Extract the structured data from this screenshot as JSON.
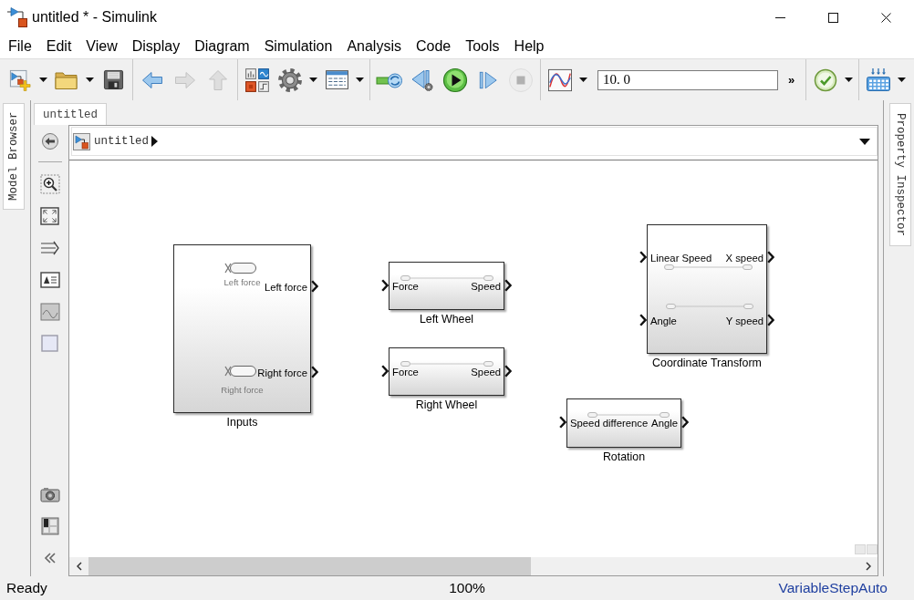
{
  "window": {
    "title": "untitled * - Simulink"
  },
  "menu": [
    {
      "label": "File"
    },
    {
      "label": "Edit"
    },
    {
      "label": "View"
    },
    {
      "label": "Display"
    },
    {
      "label": "Diagram"
    },
    {
      "label": "Simulation"
    },
    {
      "label": "Analysis"
    },
    {
      "label": "Code"
    },
    {
      "label": "Tools"
    },
    {
      "label": "Help"
    }
  ],
  "toolbar": {
    "groups": [
      {
        "items": [
          {
            "kind": "button",
            "disabled": false,
            "dropdown": true
          },
          {
            "kind": "button",
            "disabled": false,
            "dropdown": true
          },
          {
            "kind": "button",
            "disabled": false,
            "dropdown": false
          }
        ]
      },
      {
        "items": [
          {
            "kind": "button",
            "disabled": false,
            "dropdown": false
          },
          {
            "kind": "button",
            "disabled": true,
            "dropdown": false
          },
          {
            "kind": "button",
            "disabled": true,
            "dropdown": false
          }
        ]
      },
      {
        "items": [
          {
            "kind": "button",
            "disabled": false,
            "dropdown": false
          },
          {
            "kind": "button",
            "disabled": false,
            "dropdown": true
          },
          {
            "kind": "button",
            "disabled": false,
            "dropdown": true
          }
        ]
      },
      {
        "items": [
          {
            "kind": "button",
            "disabled": false,
            "dropdown": false
          },
          {
            "kind": "button",
            "disabled": false,
            "dropdown": false
          },
          {
            "kind": "button",
            "disabled": false,
            "dropdown": false
          },
          {
            "kind": "button",
            "disabled": false,
            "dropdown": false
          },
          {
            "kind": "button",
            "disabled": true,
            "dropdown": false
          }
        ]
      },
      {
        "items": [
          {
            "kind": "button",
            "disabled": false,
            "dropdown": true
          },
          {
            "kind": "field",
            "value": "10. 0"
          },
          {
            "kind": "overflow",
            "text": "»"
          }
        ]
      },
      {
        "items": [
          {
            "kind": "button",
            "disabled": false,
            "dropdown": true
          }
        ]
      },
      {
        "items": [
          {
            "kind": "button",
            "disabled": false,
            "dropdown": true
          }
        ]
      }
    ]
  },
  "side_tabs": {
    "left": "Model Browser",
    "right": "Property Inspector"
  },
  "editor_tabs": [
    {
      "label": "untitled",
      "selected": true
    }
  ],
  "breadcrumb": [
    "untitled"
  ],
  "blocks": [
    {
      "kind": "source",
      "name": "Inputs",
      "ports": [
        {
          "out": "Left force",
          "source": "Left force"
        },
        {
          "out": "Right force",
          "source": "Right force"
        }
      ]
    },
    {
      "kind": "subsystem",
      "name": "Left Wheel",
      "ports": [
        {
          "in": "Force",
          "out": "Speed"
        }
      ]
    },
    {
      "kind": "subsystem",
      "name": "Right Wheel",
      "ports": [
        {
          "in": "Force",
          "out": "Speed"
        }
      ]
    },
    {
      "kind": "subsystem",
      "name": "Coordinate Transform",
      "ports": [
        {
          "in": "Linear Speed",
          "out": "X speed"
        },
        {
          "in": "Angle",
          "out": "Y speed"
        }
      ]
    },
    {
      "kind": "subsystem",
      "name": "Rotation",
      "ports": [
        {
          "in": "Speed difference",
          "out": "Angle"
        }
      ]
    }
  ],
  "status_bar": {
    "message": "Ready",
    "zoom": "100%",
    "solver": "VariableStepAuto"
  }
}
